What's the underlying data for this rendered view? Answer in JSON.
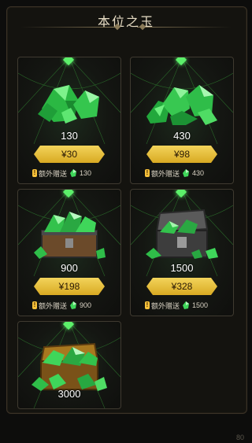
{
  "title": "本位之玉",
  "packs": [
    {
      "amount": "130",
      "price": "¥30",
      "bonus_label": "额外赠送",
      "bonus_amount": "130",
      "art": "gem-pile-icon"
    },
    {
      "amount": "430",
      "price": "¥98",
      "bonus_label": "额外赠送",
      "bonus_amount": "430",
      "art": "gem-heap-icon"
    },
    {
      "amount": "900",
      "price": "¥198",
      "bonus_label": "额外赠送",
      "bonus_amount": "900",
      "art": "gem-chest-icon"
    },
    {
      "amount": "1500",
      "price": "¥328",
      "bonus_label": "额外赠送",
      "bonus_amount": "1500",
      "art": "gem-iron-chest-icon"
    },
    {
      "amount": "3000",
      "art": "gem-gold-chest-icon"
    }
  ],
  "footer_number": "80",
  "colors": {
    "accent": "#f3d45b",
    "gem": "#3fd65a",
    "background": "#0d0d0c"
  }
}
